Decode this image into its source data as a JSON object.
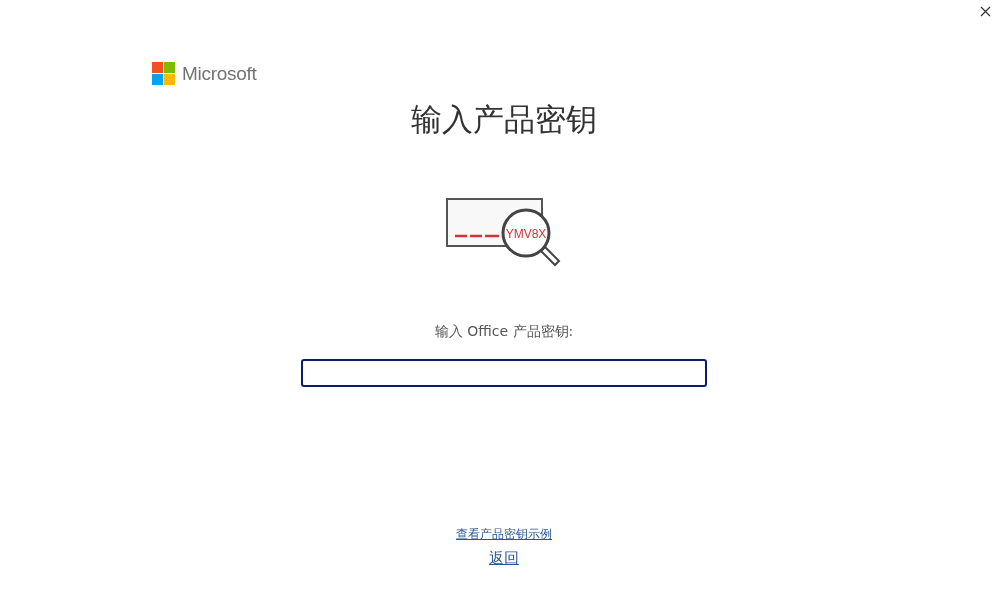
{
  "brand": {
    "name": "Microsoft"
  },
  "title": "输入产品密钥",
  "illustration": {
    "key_text": "YMV8X"
  },
  "key_field": {
    "label": "输入 Office 产品密钥:",
    "focused": true
  },
  "links": [
    {
      "label": "查看产品密钥示例",
      "kind": "small"
    },
    {
      "label": "返回",
      "kind": "large"
    }
  ]
}
